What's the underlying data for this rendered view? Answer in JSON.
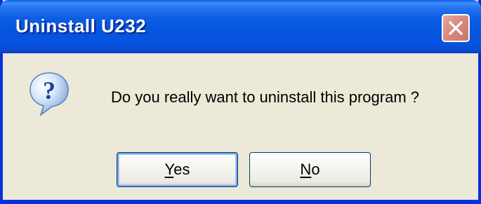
{
  "window": {
    "title": "Uninstall U232",
    "close_icon": "close-icon"
  },
  "dialog": {
    "icon": "question-icon",
    "message": "Do you really want to uninstall this program ?"
  },
  "buttons": {
    "yes": {
      "mnemonic": "Y",
      "rest": "es"
    },
    "no": {
      "mnemonic": "N",
      "rest": "o"
    }
  },
  "colors": {
    "titlebar_blue": "#0554de",
    "frame_blue": "#0831d9",
    "dialog_background": "#ece9d8",
    "close_button": "#d98b80"
  }
}
